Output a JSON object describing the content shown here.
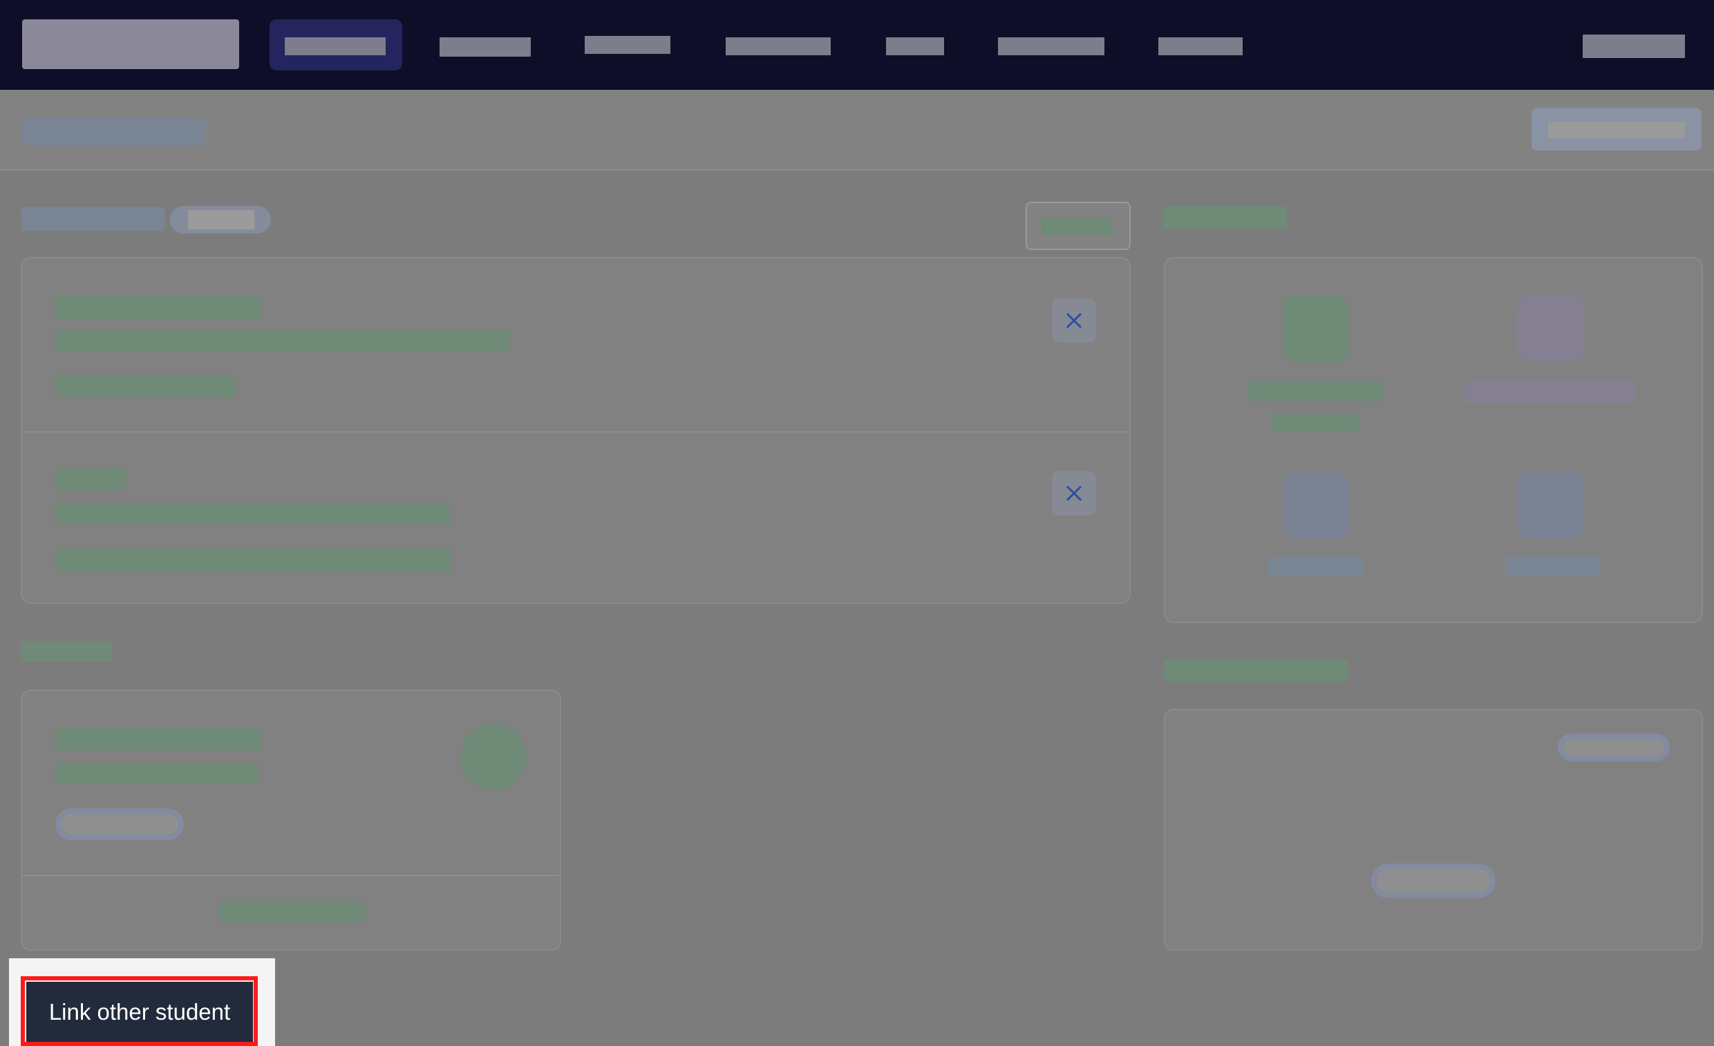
{
  "cta": {
    "label": "Link other student"
  },
  "colors": {
    "navbar": "#0e0e28",
    "overlay": "#7c7c7c",
    "cta_bg": "#222b3c",
    "highlight": "#ff1a1a"
  },
  "icons": {
    "remove": "close-icon"
  }
}
